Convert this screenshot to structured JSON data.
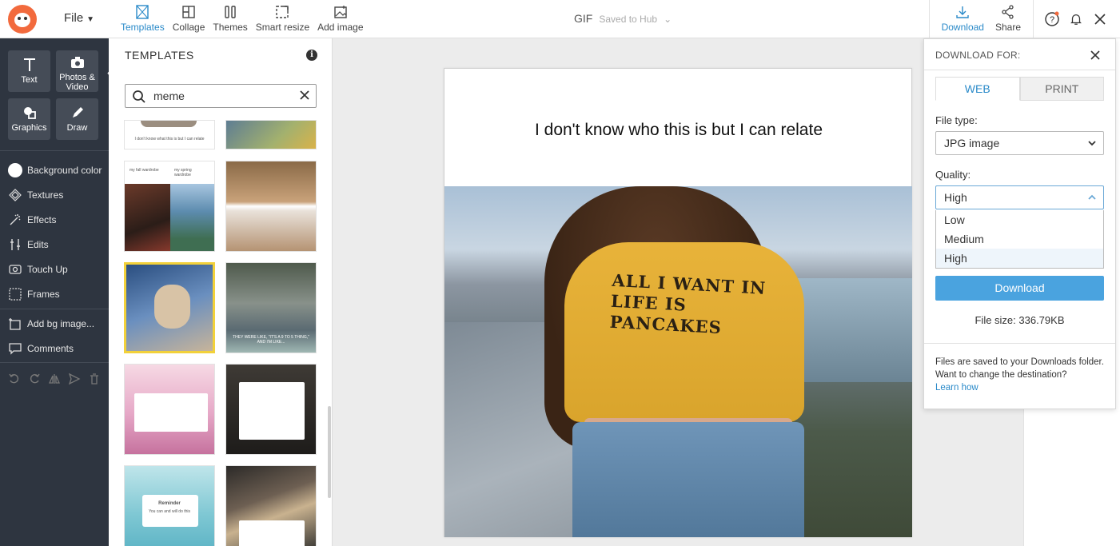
{
  "topbar": {
    "file_label": "File",
    "tabs": [
      {
        "label": "Templates",
        "icon": "templates-icon",
        "active": true
      },
      {
        "label": "Collage",
        "icon": "collage-icon"
      },
      {
        "label": "Themes",
        "icon": "themes-icon"
      },
      {
        "label": "Smart resize",
        "icon": "smart-resize-icon"
      },
      {
        "label": "Add image",
        "icon": "add-image-icon"
      }
    ],
    "doc_type": "GIF",
    "saved_status": "Saved to Hub",
    "download_label": "Download",
    "share_label": "Share"
  },
  "sidebar": {
    "tools": [
      {
        "label": "Text",
        "icon": "text-icon"
      },
      {
        "label": "Photos & Video",
        "icon": "camera-icon"
      },
      {
        "label": "Graphics",
        "icon": "graphics-icon"
      },
      {
        "label": "Draw",
        "icon": "pencil-icon"
      }
    ],
    "items": [
      {
        "label": "Background color",
        "icon": "background-color-icon"
      },
      {
        "label": "Textures",
        "icon": "textures-icon"
      },
      {
        "label": "Effects",
        "icon": "effects-icon"
      },
      {
        "label": "Edits",
        "icon": "edits-icon"
      },
      {
        "label": "Touch Up",
        "icon": "touch-up-icon"
      },
      {
        "label": "Frames",
        "icon": "frames-icon"
      },
      {
        "label": "Add bg image...",
        "icon": "add-bg-image-icon"
      },
      {
        "label": "Comments",
        "icon": "comments-icon"
      }
    ]
  },
  "templates": {
    "title": "TEMPLATES",
    "search_value": "meme",
    "thumb_captions": [
      "I don't know what this is but I can relate",
      "my fall wardrobe",
      "my spring wardrobe",
      "THEY WERE LIKE, \"IT'S A 9 TO 5 THING,\" AND I'M LIKE...",
      "Reminder",
      "You can and will do this"
    ]
  },
  "canvas": {
    "caption": "I don't know who this is but I can relate",
    "shirt_text": "ALL I WANT IN LIFE IS PANCAKES"
  },
  "download_panel": {
    "header": "DOWNLOAD FOR:",
    "tab_web": "WEB",
    "tab_print": "PRINT",
    "file_type_label": "File type:",
    "file_type_value": "JPG image",
    "quality_label": "Quality:",
    "quality_value": "High",
    "quality_options": [
      "Low",
      "Medium",
      "High"
    ],
    "download_button": "Download",
    "file_size": "File size: 336.79KB",
    "note": "Files are saved to your Downloads folder. Want to change the destination?",
    "learn_how": "Learn how"
  },
  "colors": {
    "accent": "#2a8ac9",
    "brand": "#f26a3d",
    "sidebar_bg": "#2e3540",
    "download_button": "#4aa3df"
  }
}
